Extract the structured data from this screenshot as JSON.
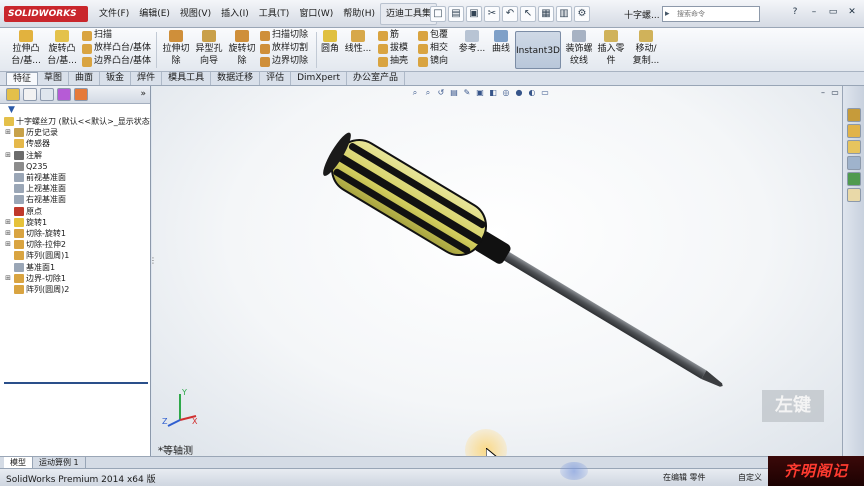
{
  "app": {
    "logo_text": "SOLIDWORKS",
    "doc_title": "十字螺...",
    "search_placeholder": "搜索命令"
  },
  "menu": {
    "items": [
      "文件(F)",
      "编辑(E)",
      "视图(V)",
      "插入(I)",
      "工具(T)",
      "窗口(W)",
      "帮助(H)",
      "迈迪工具集"
    ]
  },
  "quick_tools": [
    "□",
    "▤",
    "▣",
    "✂",
    "↶",
    "↖",
    "▦",
    "▥",
    "⚙"
  ],
  "window_controls": [
    "?",
    "–",
    "▭",
    "✕"
  ],
  "ribbon": {
    "extrude_boss": "拉伸凸\n台/基...",
    "revolve_boss": "旋转凸\n台/基...",
    "sweep": "扫描",
    "loft_boss": "放样凸台/基体",
    "boundary_boss": "边界凸台/基体",
    "extrude_cut": "拉伸切\n除",
    "hole_wizard": "异型孔\n向导",
    "revolve_cut": "旋转切\n除",
    "sweep_cut": "扫描切除",
    "loft_cut": "放样切割",
    "boundary_cut": "边界切除",
    "fillet": "圆角",
    "linear_pattern": "线性...",
    "rib": "筋",
    "draft": "拔模",
    "shell": "抽壳",
    "wrap": "包覆",
    "intersect": "相交",
    "mirror": "镜向",
    "reference": "参考...",
    "curves": "曲线",
    "instant3d": "Instant3D",
    "cosmetic_thread": "装饰螺\n纹线",
    "insert_part": "插入零\n件",
    "move_copy": "移动/\n复制..."
  },
  "tabs": [
    "特征",
    "草图",
    "曲面",
    "钣金",
    "焊件",
    "模具工具",
    "数据迁移",
    "评估",
    "DimXpert",
    "办公室产品"
  ],
  "feature_tree": {
    "filter_icon": "▼",
    "root": "十字螺丝刀 (默认<<默认>_显示状态",
    "nodes": [
      {
        "label": "历史记录",
        "expand": "⊞",
        "icon": "history-icon",
        "color": "#c8a24a"
      },
      {
        "label": "传感器",
        "expand": "",
        "icon": "sensor-icon",
        "color": "#e5b84a"
      },
      {
        "label": "注解",
        "expand": "⊞",
        "icon": "annotation-icon",
        "color": "#6b6b6b"
      },
      {
        "label": "Q235",
        "expand": "",
        "icon": "material-icon",
        "color": "#8c8c8c"
      },
      {
        "label": "前视基准面",
        "expand": "",
        "icon": "plane-icon",
        "color": "#9aa6b6"
      },
      {
        "label": "上视基准面",
        "expand": "",
        "icon": "plane-icon",
        "color": "#9aa6b6"
      },
      {
        "label": "右视基准面",
        "expand": "",
        "icon": "plane-icon",
        "color": "#9aa6b6"
      },
      {
        "label": "原点",
        "expand": "",
        "icon": "origin-icon",
        "color": "#c0392b"
      },
      {
        "label": "旋转1",
        "expand": "⊞",
        "icon": "revolve-icon",
        "color": "#e6c23a"
      },
      {
        "label": "切除-旋转1",
        "expand": "⊞",
        "icon": "cut-revolve-icon",
        "color": "#d9a441"
      },
      {
        "label": "切除-拉伸2",
        "expand": "⊞",
        "icon": "cut-extrude-icon",
        "color": "#d9a441"
      },
      {
        "label": "阵列(圆周)1",
        "expand": "",
        "icon": "pattern-icon",
        "color": "#d9a441"
      },
      {
        "label": "基准面1",
        "expand": "",
        "icon": "plane-icon",
        "color": "#9aa6b6"
      },
      {
        "label": "边界-切除1",
        "expand": "⊞",
        "icon": "boundary-cut-icon",
        "color": "#d9a441"
      },
      {
        "label": "阵列(圆周)2",
        "expand": "",
        "icon": "pattern-icon",
        "color": "#d9a441"
      }
    ]
  },
  "viewport": {
    "view_label": "*等轴测",
    "key_indicator": "左键",
    "triad_axes": [
      "X",
      "Y",
      "Z"
    ]
  },
  "model_tabs": [
    "模型",
    "运动算例 1"
  ],
  "status": {
    "app_version": "SolidWorks Premium 2014 x64 版",
    "mode": "在编辑 零件",
    "custom": "自定义",
    "watermark": "齐明阁记"
  },
  "colors": {
    "handle_yellow": "#d9d66a",
    "handle_black": "#111111",
    "shaft": "#5c5f63",
    "accent_blue": "#2a4f8a"
  }
}
